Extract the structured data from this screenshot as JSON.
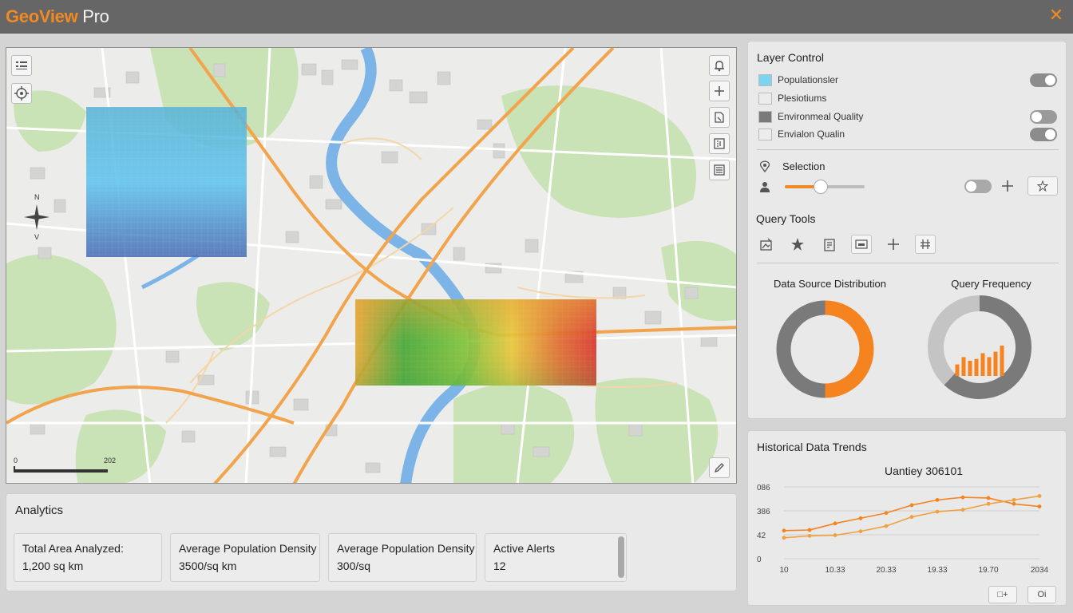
{
  "window": {
    "title_brand": "GeoView",
    "title_suffix": " Pro",
    "close_glyph": "✕"
  },
  "map": {
    "left_tools": [
      "layers-list-icon",
      "locate-crosshair-icon"
    ],
    "right_tools": [
      "bell-icon",
      "zoom-in-plus-icon",
      "document-tag-icon",
      "layer-panel-icon",
      "list-view-icon"
    ],
    "bottom_tool": "pencil-icon",
    "compass_north": "N",
    "compass_south": "V",
    "scale_start": "0",
    "scale_end": "202"
  },
  "layer_control": {
    "title": "Layer Control",
    "layers": [
      {
        "label": "Populationsler",
        "swatch": "#7ed3f0",
        "toggle": "on"
      },
      {
        "label": "Plesiotiums",
        "swatch": "#ececec",
        "toggle": "none"
      },
      {
        "label": "Environmeal Quality",
        "swatch": "#7a7a7a",
        "toggle": "off"
      },
      {
        "label": "Envialon Qualin",
        "swatch": "#ececec",
        "toggle": "on"
      }
    ],
    "selection": {
      "title": "Selection",
      "title_icon": "map-pin-icon",
      "person_icon": "person-icon",
      "slider_value": 0.45,
      "toggle": "off",
      "add_icon": "plus-icon",
      "star_icon": "star-icon"
    }
  },
  "query_tools": {
    "title": "Query Tools",
    "tools": [
      "image-query-icon",
      "star-filled-icon",
      "clipboard-icon",
      "window-box-icon",
      "plus-cross-icon",
      "grid-hash-icon"
    ]
  },
  "chart_data": [
    {
      "type": "pie",
      "title": "Data Source Distribution",
      "values": [
        50,
        50
      ],
      "colors": [
        "#f5831f",
        "#7a7a7a"
      ]
    },
    {
      "type": "pie",
      "title": "Query Frequency",
      "values": [
        62,
        38
      ],
      "colors": [
        "#7a7a7a",
        "#c4c4c4"
      ],
      "inner_bars": [
        0.38,
        0.62,
        0.5,
        0.56,
        0.75,
        0.62,
        0.8,
        1.0
      ],
      "inner_bar_color": "#f5831f"
    },
    {
      "type": "line",
      "title": "Historical Data Trends",
      "subtitle": "Uantiey 306101",
      "ytick_labels": [
        "0",
        "42",
        "386",
        "086"
      ],
      "xtick_labels": [
        "10",
        "10.33",
        "20.33",
        "19.33",
        "19.70",
        "2034"
      ],
      "x": [
        0,
        1,
        2,
        3,
        4,
        5,
        6,
        7,
        8,
        9,
        10
      ],
      "series": [
        {
          "values": [
            43,
            44,
            54,
            62,
            70,
            82,
            90,
            94,
            93,
            84,
            80
          ],
          "color": "#f5831f"
        },
        {
          "values": [
            32,
            35,
            36,
            42,
            50,
            64,
            72,
            75,
            84,
            90,
            96
          ],
          "color": "#f0a040"
        }
      ],
      "ylim": [
        0,
        110
      ],
      "grid": true,
      "buttons": [
        "□+",
        "Oi"
      ]
    }
  ],
  "trends": {
    "title": "Historical Data Trends",
    "subtitle": "Uantiey 306101",
    "button_left": "□+",
    "button_right": "Oi"
  },
  "analytics": {
    "title": "Analytics",
    "cards": [
      {
        "label": "Total Area Analyzed:",
        "value": "1,200 sq km"
      },
      {
        "label": "Average Population Density",
        "value": "3500/sq km"
      },
      {
        "label": "Average Population Density",
        "value": "300/sq"
      },
      {
        "label": "Active Alerts",
        "value": "12"
      }
    ]
  },
  "colors": {
    "accent": "#f08a24",
    "titlebar": "#666666",
    "panel": "#e9e9e9",
    "road_major": "#f2a44c",
    "river": "#7cb4e8",
    "park": "#c9e2b6"
  }
}
